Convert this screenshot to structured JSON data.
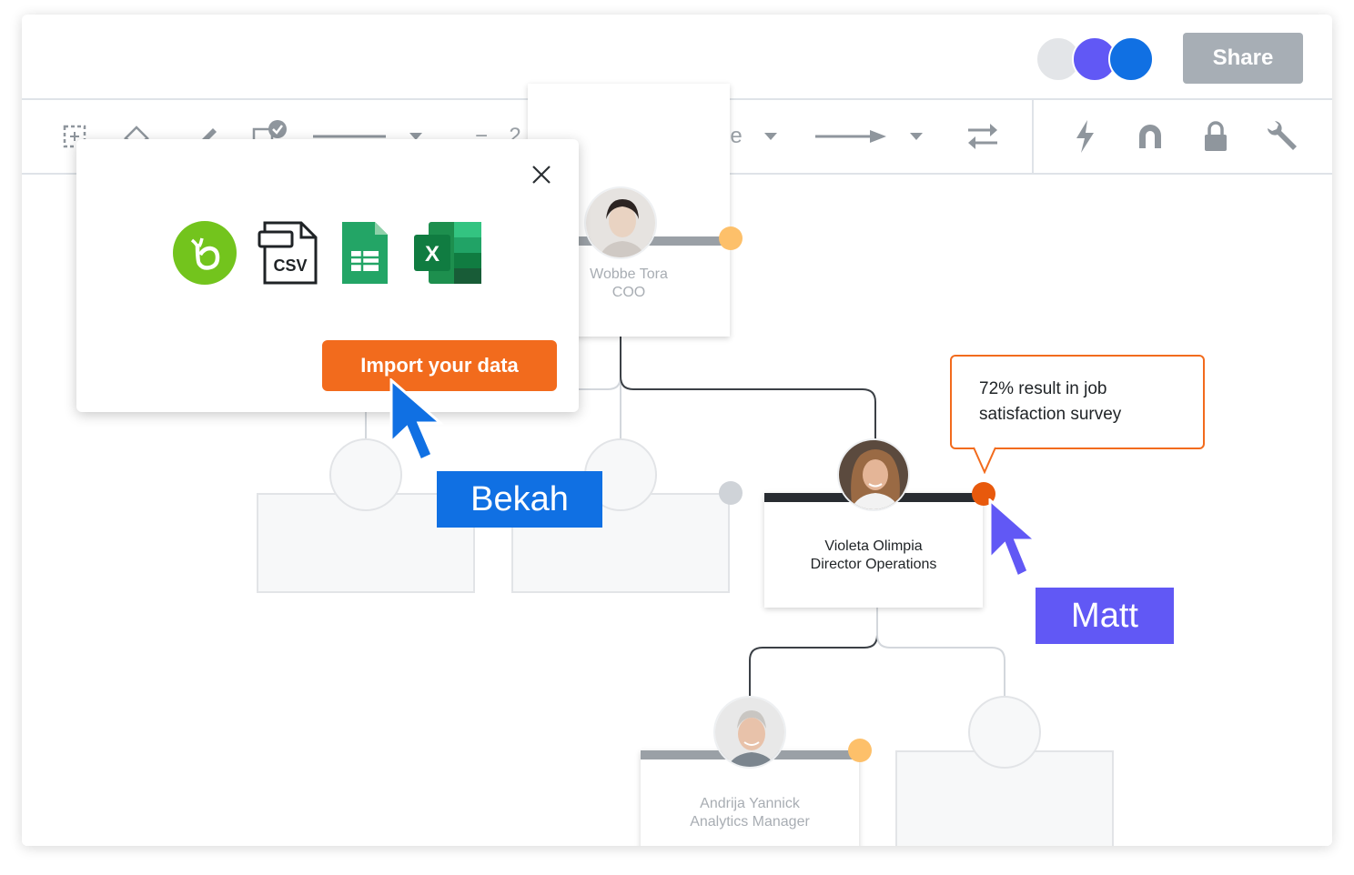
{
  "topbar": {
    "share_label": "Share",
    "collaborator_colors": [
      "#e3e5e8",
      "#6158f5",
      "#1070e3"
    ]
  },
  "toolbar": {
    "line_width_minus": "−",
    "line_width_value": "2 px",
    "line_width_plus": "+",
    "arrow_start_value": "None"
  },
  "popup": {
    "file_types": [
      "bamboohr-icon",
      "csv-icon",
      "google-sheets-icon",
      "excel-icon"
    ],
    "csv_label": "CSV",
    "excel_letter": "X",
    "import_label": "Import your data"
  },
  "org_chart": {
    "nodes": [
      {
        "name": "Wobbe Tora",
        "role": "COO",
        "status_color": "#fdc06a"
      },
      {
        "name": "Violeta Olimpia",
        "role": "Director Operations",
        "status_color": "#e8590c"
      },
      {
        "name": "Andrija Yannick",
        "role": "Analytics Manager",
        "status_color": "#fdc06a"
      }
    ],
    "comment": "72% result in job satisfaction survey"
  },
  "cursors": [
    {
      "name": "Bekah",
      "color": "#1070e3"
    },
    {
      "name": "Matt",
      "color": "#6158f5"
    }
  ]
}
